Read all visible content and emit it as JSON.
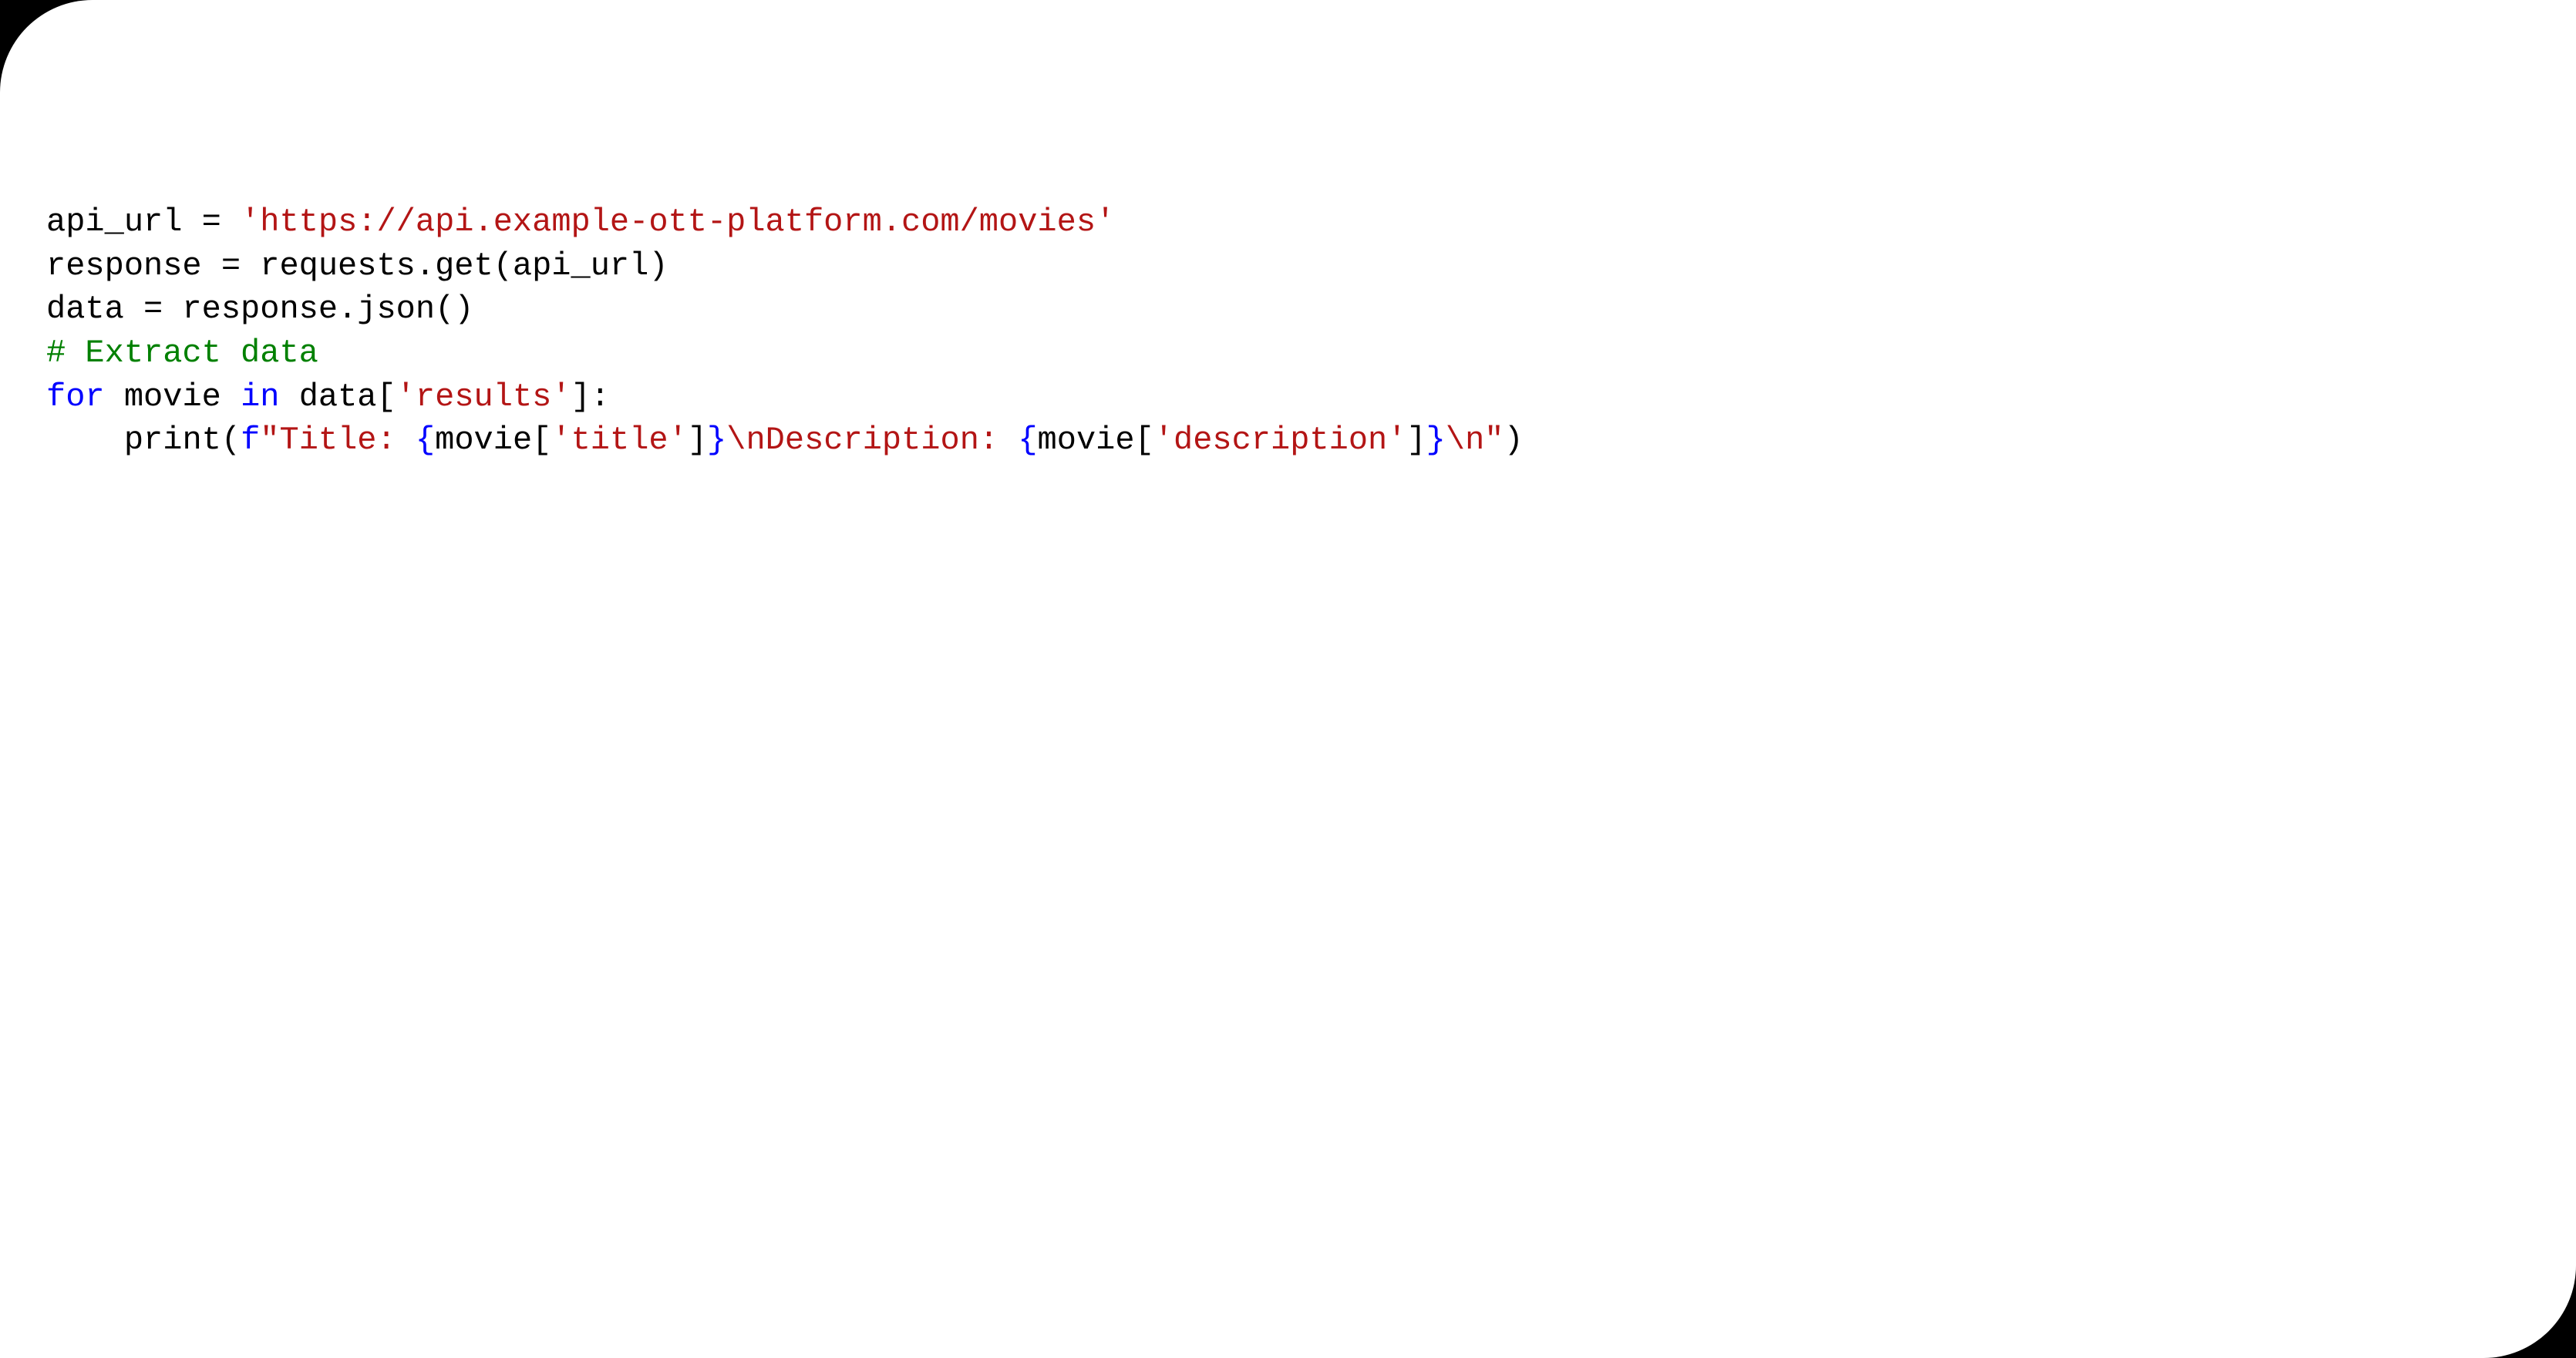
{
  "code": {
    "line1": {
      "a": "api_url = ",
      "b": "'https://api.example-ott-platform.com/movies'"
    },
    "line2": "response = requests.get(api_url)",
    "line3": "data = response.json()",
    "line4": "# Extract data",
    "line5": {
      "a": "for",
      "b": " movie ",
      "c": "in",
      "d": " data[",
      "e": "'results'",
      "f": "]:"
    },
    "line6": {
      "indent": "    ",
      "a": "print(",
      "fpre": "f",
      "s1": "\"Title: ",
      "i1o": "{",
      "i1": "movie[",
      "i1s": "'title'",
      "i1c": "]",
      "i1e": "}",
      "s2": "\\n",
      "s3": "Description: ",
      "i2o": "{",
      "i2": "movie[",
      "i2s": "'description'",
      "i2c": "]",
      "i2e": "}",
      "s4": "\\n",
      "s5": "\"",
      "z": ")"
    }
  }
}
